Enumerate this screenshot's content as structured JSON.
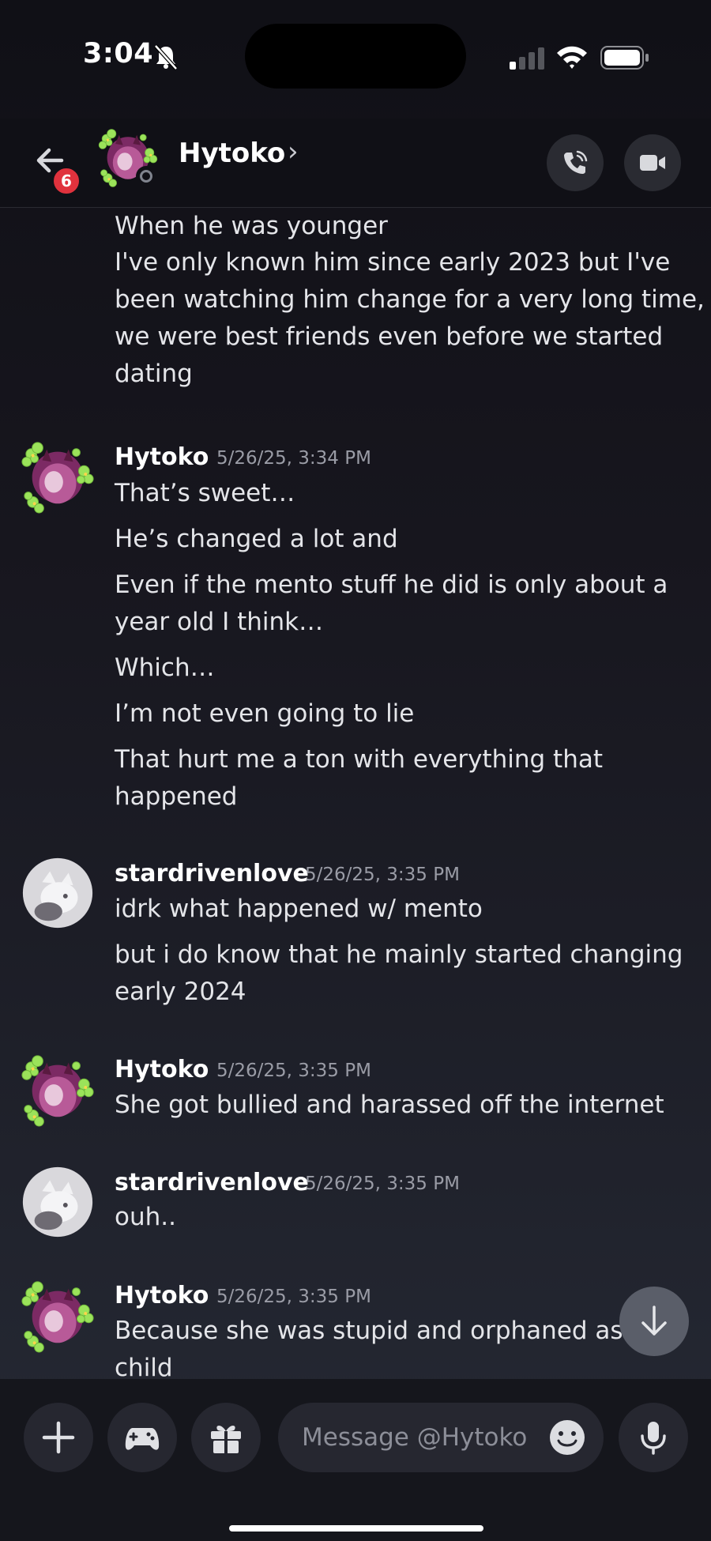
{
  "status_bar": {
    "time": "3:04"
  },
  "header": {
    "back_badge": "6",
    "contact_name": "Hytoko",
    "chevron": "›"
  },
  "messages": {
    "continuation": [
      "When he was younger",
      "I've only known him since early 2023 but I've",
      "been watching him change for a very long time,",
      "we were best friends even before we started",
      "dating"
    ],
    "groups": [
      {
        "author": "Hytoko",
        "timestamp": "5/26/25, 3:34 PM",
        "lines": [
          "That’s sweet…",
          "He’s changed a lot and",
          "Even if the mento stuff he did is only about a",
          "year old I think…",
          "Which…",
          "I’m not even going to lie",
          "That hurt me a ton with everything that",
          "happened"
        ]
      },
      {
        "author": "stardrivenlove",
        "timestamp": "5/26/25, 3:35 PM",
        "lines": [
          "idrk what happened w/ mento",
          "but i do know that he mainly started changing",
          "early 2024"
        ]
      },
      {
        "author": "Hytoko",
        "timestamp": "5/26/25, 3:35 PM",
        "lines": [
          "She got bullied and harassed off the internet"
        ]
      },
      {
        "author": "stardrivenlove",
        "timestamp": "5/26/25, 3:35 PM",
        "lines": [
          "ouh.."
        ]
      },
      {
        "author": "Hytoko",
        "timestamp": "5/26/25, 3:35 PM",
        "lines": [
          "Because she was stupid and orphaned as a",
          "child"
        ]
      }
    ]
  },
  "composer": {
    "placeholder": "Message @Hytoko"
  },
  "icons": {
    "header": [
      "back-arrow-icon",
      "voice-call-icon",
      "video-camera-icon"
    ],
    "composer": [
      "plus-icon",
      "gamepad-icon",
      "gift-icon",
      "emoji-icon",
      "microphone-icon"
    ],
    "scroll": "arrow-down-icon"
  },
  "colors": {
    "badge": "#e0323d",
    "accent_green": "#9be35a",
    "avatar_purple": "#8a2f6e"
  }
}
